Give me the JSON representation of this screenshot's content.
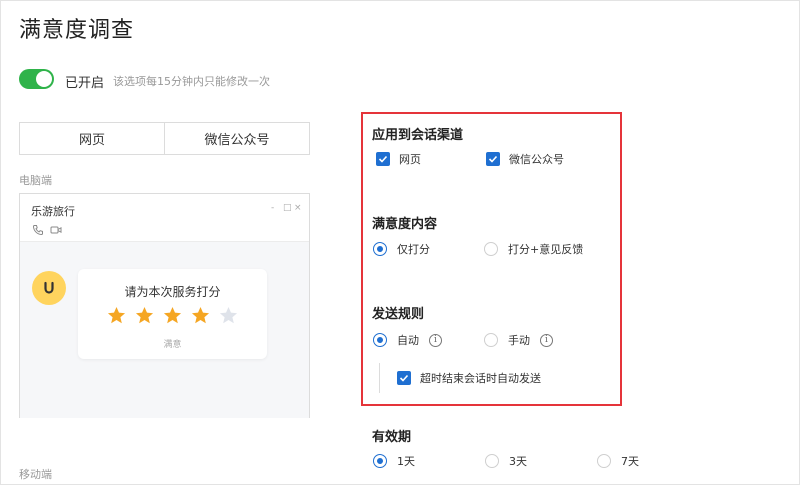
{
  "page": {
    "title": "满意度调查"
  },
  "toggle": {
    "state": "已开启",
    "hint": "该选项每15分钟内只能修改一次"
  },
  "tabs": [
    {
      "label": "网页"
    },
    {
      "label": "微信公众号"
    }
  ],
  "sections": {
    "desktop": "电脑端",
    "mobile": "移动端"
  },
  "preview": {
    "name": "乐游旅行",
    "window_controls": [
      "-",
      "□",
      "×"
    ],
    "rating_prompt": "请为本次服务打分",
    "stars": 4,
    "stars_total": 5,
    "rating_text": "满意"
  },
  "channels": {
    "heading": "应用到会话渠道",
    "options": [
      {
        "label": "网页",
        "checked": true
      },
      {
        "label": "微信公众号",
        "checked": true
      }
    ]
  },
  "content": {
    "heading": "满意度内容",
    "options": [
      {
        "label": "仅打分",
        "selected": true
      },
      {
        "label": "打分+意见反馈",
        "selected": false
      }
    ]
  },
  "send_rule": {
    "heading": "发送规则",
    "options": [
      {
        "label": "自动",
        "selected": true
      },
      {
        "label": "手动",
        "selected": false
      }
    ],
    "auto_send_label": "超时结束会话时自动发送",
    "auto_send_checked": true
  },
  "validity": {
    "heading": "有效期",
    "options": [
      {
        "label": "1天",
        "selected": true
      },
      {
        "label": "3天",
        "selected": false
      },
      {
        "label": "7天",
        "selected": false
      }
    ]
  },
  "colors": {
    "accent": "#1f6fd1",
    "toggle_on": "#2fb34a",
    "star": "#f5a623",
    "star_off": "#dfe3ea",
    "highlight_border": "#e5343a",
    "avatar": "#ffd45e"
  }
}
